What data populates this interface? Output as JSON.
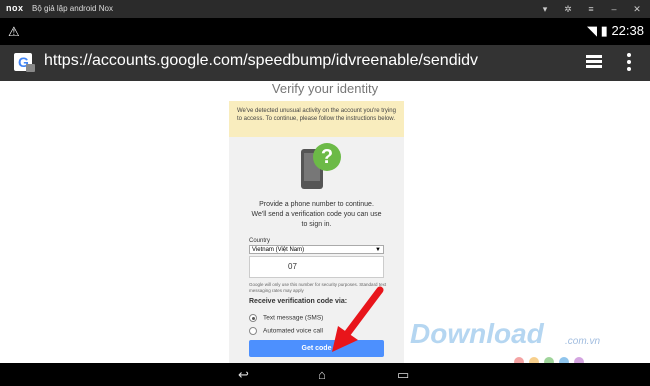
{
  "window": {
    "logo": "nox",
    "title": "Bộ giả lập android Nox"
  },
  "status": {
    "warning_icon": "warning-icon",
    "time": "22:38",
    "wifi": "wifi-icon",
    "signal": "signal-icon",
    "battery": "battery-icon"
  },
  "browser": {
    "url": "https://accounts.google.com/speedbump/idvreenable/sendidv",
    "favicon_letter": "G"
  },
  "page": {
    "title": "Verify your identity",
    "alert": "We've detected unusual activity on the account you're trying to access. To continue, please follow the instructions below.",
    "instructions": "Provide a phone number to continue. We'll send a verification code you can use to sign in.",
    "country_label": "Country",
    "country_value": "Vietnam (Việt Nam)",
    "phone_prefix": "07",
    "note": "Google will only use this number for security purposes. Standard text messaging rates may apply",
    "receive_label": "Receive verification code via:",
    "options": [
      {
        "label": "Text message (SMS)",
        "checked": true
      },
      {
        "label": "Automated voice call",
        "checked": false
      }
    ],
    "button_label": "Get code"
  },
  "watermark": {
    "text": "Download",
    "sub": ".com.vn"
  },
  "colors": {
    "accent": "#4d90fe",
    "alert_bg": "#f9edbe",
    "arrow": "#e8151b"
  }
}
